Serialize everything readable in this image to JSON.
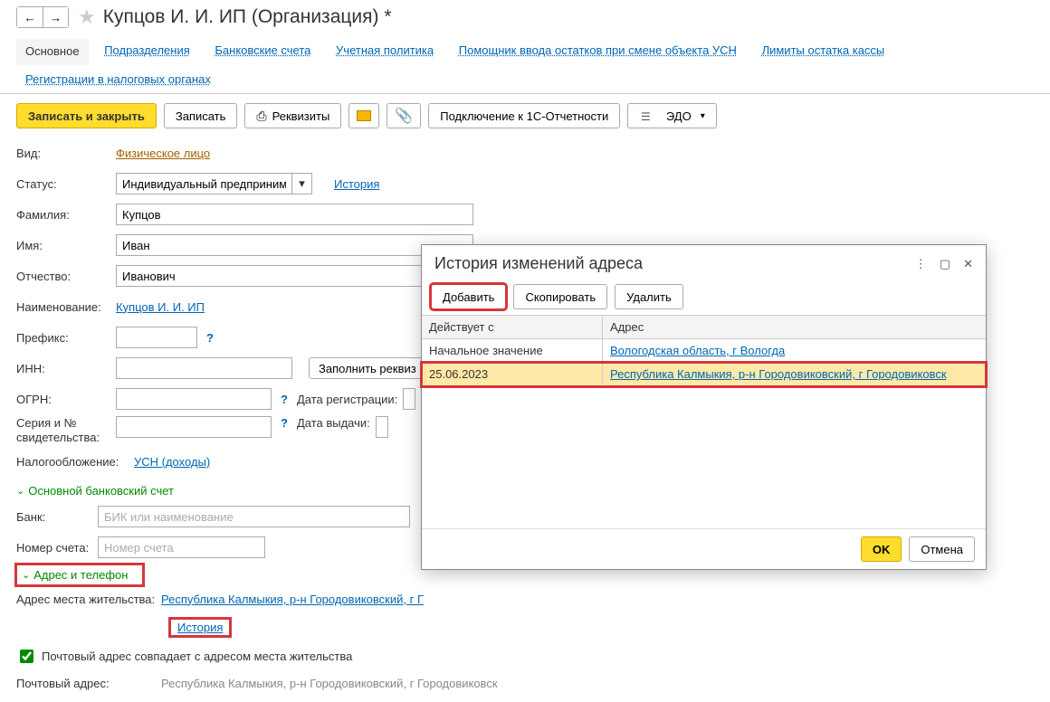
{
  "header": {
    "title": "Купцов И. И. ИП (Организация) *"
  },
  "tabs": [
    "Основное",
    "Подразделения",
    "Банковские счета",
    "Учетная политика",
    "Помощник ввода остатков при смене объекта УСН",
    "Лимиты остатка кассы",
    "Регистрации в налоговых органах"
  ],
  "toolbar": {
    "save_close": "Записать и закрыть",
    "save": "Записать",
    "requisites": "Реквизиты",
    "connect": "Подключение к 1С-Отчетности",
    "edo": "ЭДО"
  },
  "form": {
    "vid_label": "Вид:",
    "vid_value": "Физическое лицо",
    "status_label": "Статус:",
    "status_value": "Индивидуальный предприниматель",
    "history_link": "История",
    "fam_label": "Фамилия:",
    "fam_value": "Купцов",
    "name_label": "Имя:",
    "name_value": "Иван",
    "patr_label": "Отчество:",
    "patr_value": "Иванович",
    "full_label": "Наименование:",
    "full_value": "Купцов И. И. ИП",
    "prefix_label": "Префикс:",
    "prefix_value": "",
    "inn_label": "ИНН:",
    "inn_value": "",
    "fill_btn": "Заполнить реквиз",
    "ogrn_label": "ОГРН:",
    "ogrn_value": "",
    "reg_date_label": "Дата регистрации:",
    "reg_date_value": "",
    "serial_label": "Серия и № свидетельства:",
    "serial_value": "",
    "issue_date_label": "Дата выдачи:",
    "issue_date_value": "",
    "tax_label": "Налогообложение:",
    "tax_value": "УСН (доходы)",
    "bank_section": "Основной банковский счет",
    "bank_label": "Банк:",
    "bank_placeholder": "БИК или наименование",
    "acc_label": "Номер счета:",
    "acc_placeholder": "Номер счета",
    "addr_section": "Адрес и телефон",
    "addr_label": "Адрес места жительства:",
    "addr_value": "Республика Калмыкия, р-н Городовиковский, г Г",
    "history2": "История",
    "same_checkbox": "Почтовый адрес совпадает с адресом места жительства",
    "post_label": "Почтовый адрес:",
    "post_value": "Республика Калмыкия, р-н Городовиковский, г Городовиковск"
  },
  "popup": {
    "title": "История изменений адреса",
    "add": "Добавить",
    "copy": "Скопировать",
    "del": "Удалить",
    "th1": "Действует с",
    "th2": "Адрес",
    "row1_date": "Начальное значение",
    "row1_addr": "Вологодская область, г Вологда",
    "row2_date": "25.06.2023",
    "row2_addr": "Республика Калмыкия, р-н Городовиковский, г Городовиковск",
    "ok": "OK",
    "cancel": "Отмена"
  }
}
